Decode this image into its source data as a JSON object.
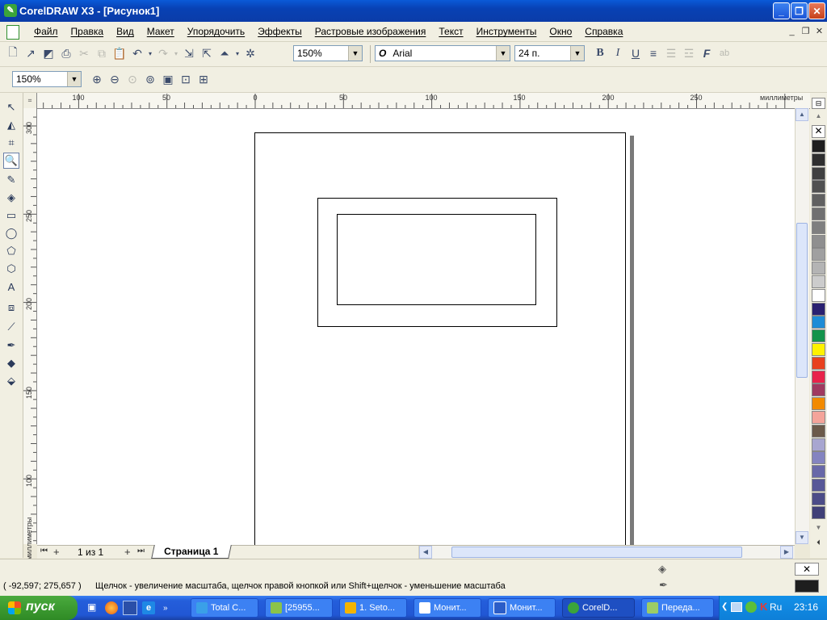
{
  "window": {
    "title": "CorelDRAW X3 - [Рисунок1]"
  },
  "menu": [
    "Файл",
    "Правка",
    "Вид",
    "Макет",
    "Упорядочить",
    "Эффекты",
    "Растровые изображения",
    "Текст",
    "Инструменты",
    "Окно",
    "Справка"
  ],
  "toolbar": {
    "zoom_value": "150%",
    "font_icon": "O",
    "font_name": "Arial",
    "font_size": "24 п."
  },
  "zoombar": {
    "zoom_value": "150%"
  },
  "rulers": {
    "h_labels": [
      "100",
      "50",
      "0",
      "50",
      "100",
      "150",
      "200",
      "250"
    ],
    "h_unit": "миллиметры",
    "v_labels": [
      "300",
      "250",
      "200",
      "150",
      "100"
    ],
    "v_unit": "миллиметры"
  },
  "pages": {
    "counter": "1 из 1",
    "tab": "Страница 1"
  },
  "status": {
    "coords": "( -92,597; 275,657 )",
    "hint": "Щелчок - увеличение масштаба, щелчок правой кнопкой или Shift+щелчок - уменьшение масштаба"
  },
  "palette": [
    "#1E1E1E",
    "#2F2F2F",
    "#404040",
    "#505050",
    "#606060",
    "#707070",
    "#7F7F7F",
    "#8F8F8F",
    "#A0A0A0",
    "#B4B4B4",
    "#CCCCCC",
    "#FFFFFF",
    "#2A2070",
    "#1E8CD6",
    "#13934A",
    "#FFF200",
    "#E8411E",
    "#E8234A",
    "#A03A60",
    "#F28A00",
    "#F4A49A",
    "#6B5A4A",
    "#A8A6D0",
    "#8484C0",
    "#6868A8",
    "#585898",
    "#4C4C88",
    "#404078"
  ],
  "taskbar": {
    "start": "пуск",
    "tasks": [
      "Total C...",
      "[25955...",
      "1. Seto...",
      "Монит...",
      "Монит...",
      "CorelD...",
      "Переда..."
    ],
    "tray": {
      "lang": "Ru",
      "time": "23:16"
    }
  }
}
